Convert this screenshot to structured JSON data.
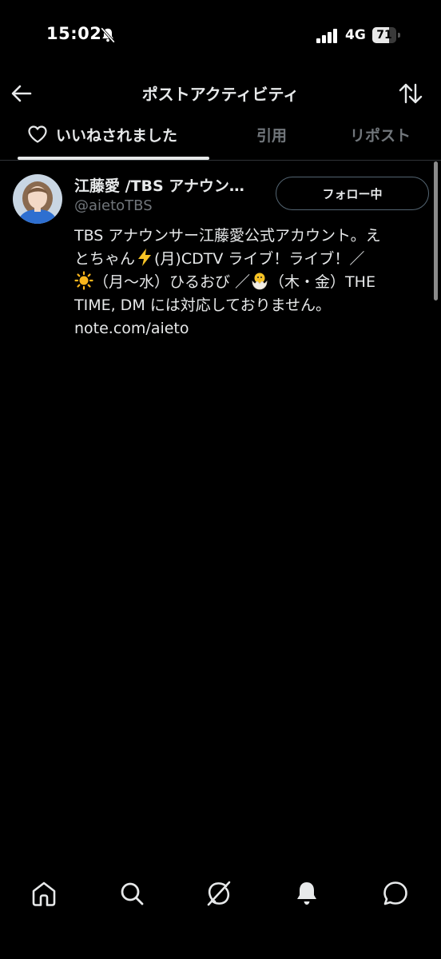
{
  "status_bar": {
    "time": "15:02",
    "network": "4G",
    "battery": "71",
    "battery_level": 0.71,
    "icons": [
      "bell-slash-icon",
      "signal-icon",
      "battery-icon"
    ]
  },
  "header": {
    "title": "ポストアクティビティ",
    "back_icon": "arrow-left-icon",
    "sort_icon": "sort-arrows-icon"
  },
  "tabs": [
    {
      "label": "いいねされました",
      "icon": "heart-icon",
      "active": true
    },
    {
      "label": "引用",
      "active": false
    },
    {
      "label": "リポスト",
      "active": false
    }
  ],
  "user": {
    "display_name": "江藤愛 /TBS アナウン…",
    "handle": "@aietoTBS",
    "follow_label": "フォロー中",
    "bio_lines": [
      {
        "text": "TBS アナウンサー江藤愛公式アカウント。え"
      },
      {
        "before": "とちゃん",
        "emoji": "high-voltage-emoji",
        "after": "(月)CDTV ライブ！ライブ！／"
      },
      {
        "emoji": "sun-emoji",
        "after": "（月〜水）ひるおび ／",
        "emoji2": "hatching-chick-emoji",
        "after2": "（木・金）THE"
      },
      {
        "text": "TIME, DM には対応しておりません。"
      }
    ],
    "link": "note.com/aieto"
  },
  "bottom_nav": [
    "home-icon",
    "search-icon",
    "grok-icon",
    "notifications-icon",
    "messages-icon"
  ],
  "colors": {
    "background": "#000000",
    "text_primary": "#e7e9ea",
    "text_secondary": "#71767b",
    "border": "#2f3336"
  }
}
